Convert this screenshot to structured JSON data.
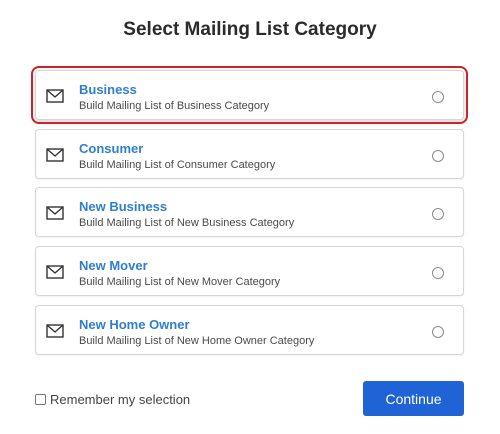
{
  "page": {
    "title": "Select Mailing List Category"
  },
  "options": [
    {
      "title": "Business",
      "description": "Build Mailing List of Business Category",
      "selected": true,
      "icon": "envelope-icon"
    },
    {
      "title": "Consumer",
      "description": "Build Mailing List of Consumer Category",
      "selected": false,
      "icon": "envelope-icon"
    },
    {
      "title": "New Business",
      "description": "Build Mailing List of New Business Category",
      "selected": false,
      "icon": "envelope-icon"
    },
    {
      "title": "New Mover",
      "description": "Build Mailing List of New Mover Category",
      "selected": false,
      "icon": "envelope-icon"
    },
    {
      "title": "New Home Owner",
      "description": "Build Mailing List of New Home Owner Category",
      "selected": false,
      "icon": "envelope-icon"
    }
  ],
  "remember": {
    "label": "Remember my selection",
    "checked": false
  },
  "actions": {
    "continue_label": "Continue"
  },
  "colors": {
    "accent": "#2f7fd1",
    "button": "#1f63d6",
    "highlight": "#c8242b"
  }
}
